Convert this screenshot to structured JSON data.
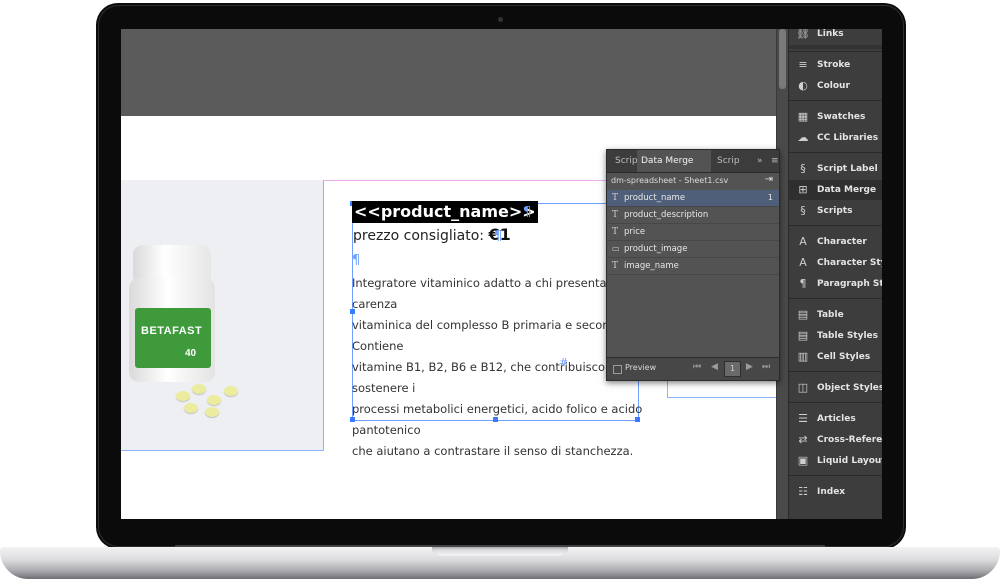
{
  "document": {
    "product_name": "<<product_name>>",
    "price_label": "prezzo consigliato: ",
    "price_value": "€1",
    "description": "Integratore vitaminico adatto a chi presenta stati di carenza\nvitaminica del complesso B primaria e secondaria. Contiene\nvitamine B1, B2, B6 e B12, che contribuiscono a sostenere i\nprocessi metabolici energetici, acido folico e acido pantotenico\nche aiutano a contrastare il senso di stanchezza.",
    "pilcrow": "¶",
    "end_mark": "#",
    "bottle_brand": "BETAFAST",
    "bottle_count": "40"
  },
  "data_merge": {
    "tabs": [
      "Scrip",
      "Data Merge",
      "Scrip"
    ],
    "menu_glyph": "≡",
    "collapse_glyph": "»",
    "csv_name": "dm-spreadsheet - Sheet1.csv",
    "fields": [
      {
        "label": "product_name",
        "type": "text",
        "count": "1",
        "selected": true
      },
      {
        "label": "product_description",
        "type": "text",
        "count": "",
        "selected": false
      },
      {
        "label": "price",
        "type": "text",
        "count": "",
        "selected": false
      },
      {
        "label": "product_image",
        "type": "image",
        "count": "",
        "selected": false
      },
      {
        "label": "image_name",
        "type": "text",
        "count": "",
        "selected": false
      }
    ],
    "text_type_glyph": "T",
    "image_type_glyph": "▭",
    "preview_label": "Preview",
    "page_number": "1"
  },
  "dock": {
    "items": [
      {
        "label": "Links",
        "icon": "links-icon",
        "glyph": "⛓"
      },
      {
        "label": "Stroke",
        "icon": "stroke-icon",
        "glyph": "≡"
      },
      {
        "label": "Colour",
        "icon": "colour-icon",
        "glyph": "◐"
      },
      {
        "label": "Swatches",
        "icon": "swatches-icon",
        "glyph": "▦"
      },
      {
        "label": "CC Libraries",
        "icon": "cc-libraries-icon",
        "glyph": "☁"
      },
      {
        "label": "Script Label",
        "icon": "script-label-icon",
        "glyph": "§"
      },
      {
        "label": "Data Merge",
        "icon": "data-merge-icon",
        "glyph": "⊞"
      },
      {
        "label": "Scripts",
        "icon": "scripts-icon",
        "glyph": "§"
      },
      {
        "label": "Character",
        "icon": "character-icon",
        "glyph": "A"
      },
      {
        "label": "Character Styles",
        "icon": "character-styles-icon",
        "glyph": "A"
      },
      {
        "label": "Paragraph Styles",
        "icon": "paragraph-styles-icon",
        "glyph": "¶"
      },
      {
        "label": "Table",
        "icon": "table-icon",
        "glyph": "▤"
      },
      {
        "label": "Table Styles",
        "icon": "table-styles-icon",
        "glyph": "▤"
      },
      {
        "label": "Cell Styles",
        "icon": "cell-styles-icon",
        "glyph": "▥"
      },
      {
        "label": "Object Styles",
        "icon": "object-styles-icon",
        "glyph": "◫"
      },
      {
        "label": "Articles",
        "icon": "articles-icon",
        "glyph": "☰"
      },
      {
        "label": "Cross-References",
        "icon": "cross-references-icon",
        "glyph": "⇄"
      },
      {
        "label": "Liquid Layout",
        "icon": "liquid-layout-icon",
        "glyph": "▣"
      },
      {
        "label": "Index",
        "icon": "index-icon",
        "glyph": "☷"
      }
    ],
    "active": "Data Merge"
  }
}
